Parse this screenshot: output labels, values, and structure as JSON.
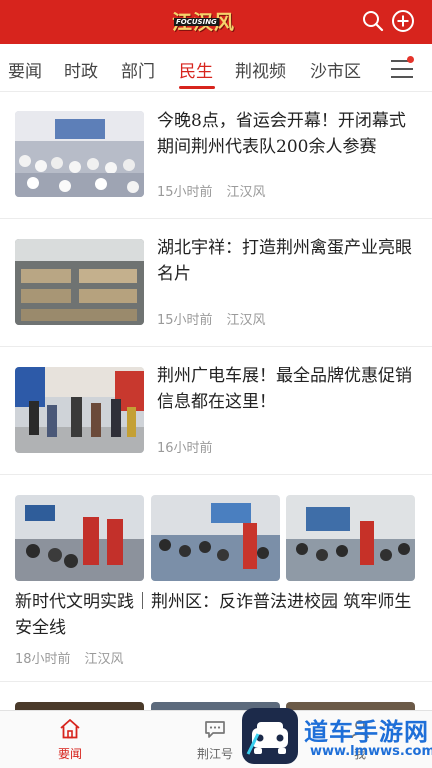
{
  "header": {
    "logo_text": "江汉风",
    "logo_subtext": "FOCUSING",
    "search_icon": "search-icon",
    "add_icon": "plus-circle-icon",
    "brand_color": "#d7241d"
  },
  "tabs": {
    "items": [
      {
        "label": "要闻"
      },
      {
        "label": "时政"
      },
      {
        "label": "部门"
      },
      {
        "label": "民生"
      },
      {
        "label": "荆视频"
      },
      {
        "label": "沙市区"
      }
    ],
    "active": "民生",
    "menu_icon": "menu-icon"
  },
  "feed": [
    {
      "title": "今晚8点，省运会开幕！开闭幕式期间荆州代表队200余人参赛",
      "time": "15小时前",
      "source": "江汉风"
    },
    {
      "title": "湖北宇祥：打造荆州禽蛋产业亮眼名片",
      "time": "15小时前",
      "source": "江汉风"
    },
    {
      "title": "荆州广电车展！最全品牌优惠促销信息都在这里！",
      "time": "16小时前"
    },
    {
      "title": "新时代文明实践｜荆州区：反诈普法进校园 筑牢师生安全线",
      "time": "18小时前",
      "source": "江汉风"
    }
  ],
  "bottom_nav": [
    {
      "label": "要闻",
      "icon": "home-icon"
    },
    {
      "label": "荆江号",
      "icon": "chat-icon"
    },
    {
      "label": "我",
      "icon": "user-icon"
    }
  ],
  "watermark": {
    "text": "道车手游网",
    "url": "www.lmwws.com"
  }
}
